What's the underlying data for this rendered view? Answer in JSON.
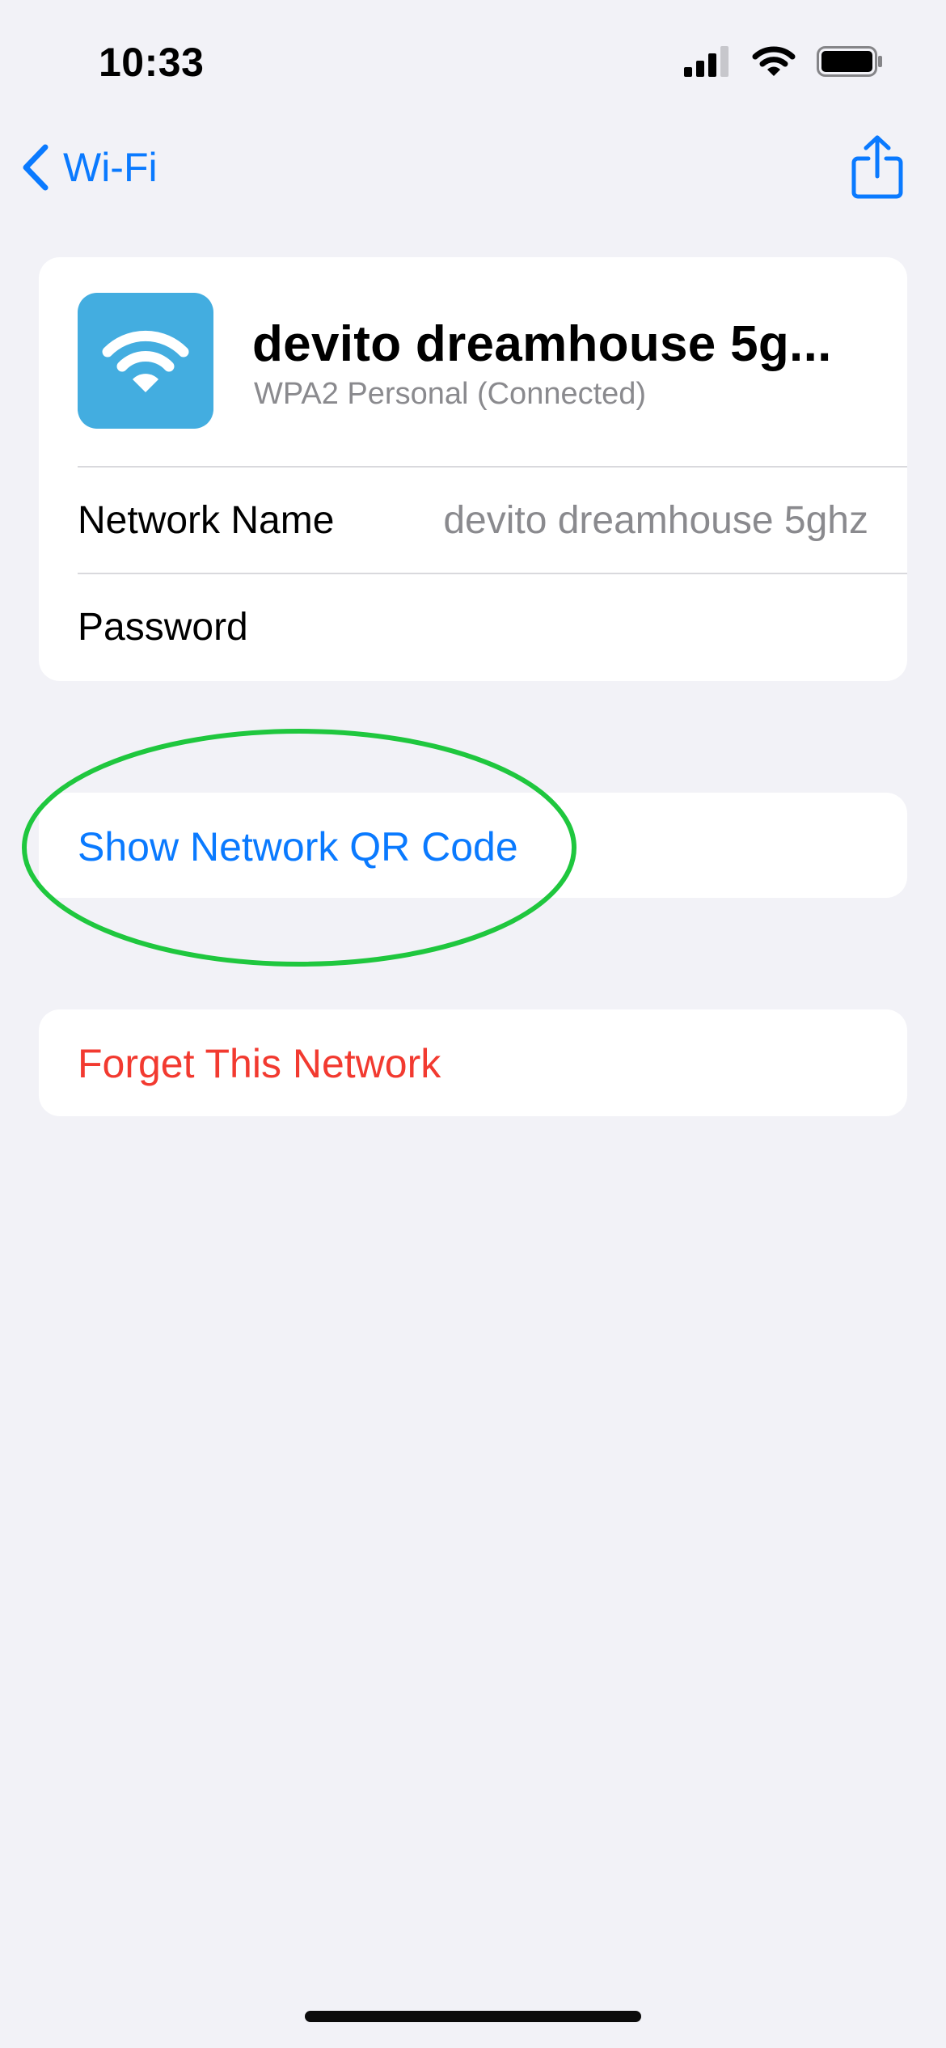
{
  "status_bar": {
    "time": "10:33"
  },
  "nav": {
    "back_label": "Wi-Fi"
  },
  "network": {
    "title": "devito dreamhouse 5g...",
    "subtitle": "WPA2 Personal (Connected)",
    "rows": [
      {
        "label": "Network Name",
        "value": "devito dreamhouse 5ghz"
      },
      {
        "label": "Password",
        "value": ""
      }
    ]
  },
  "actions": {
    "show_qr": "Show Network QR Code",
    "forget": "Forget This Network"
  },
  "colors": {
    "accent": "#0a7aff",
    "destructive": "#f23a30",
    "wifi_tile": "#43ade0",
    "annotation_ring": "#1fc73e"
  }
}
